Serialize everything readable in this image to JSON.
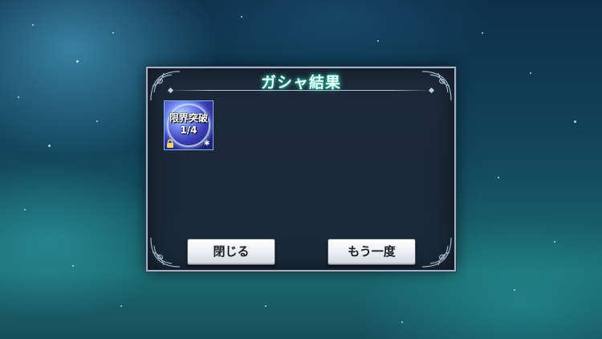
{
  "dialog": {
    "title": "ガシャ結果",
    "accent_color": "#3fd9c0"
  },
  "result_items": [
    {
      "name": "限界突破",
      "count": "1/4",
      "icon": "limit-break-orb-icon",
      "locked": true
    }
  ],
  "buttons": {
    "close_label": "閉じる",
    "again_label": "もう一度"
  }
}
